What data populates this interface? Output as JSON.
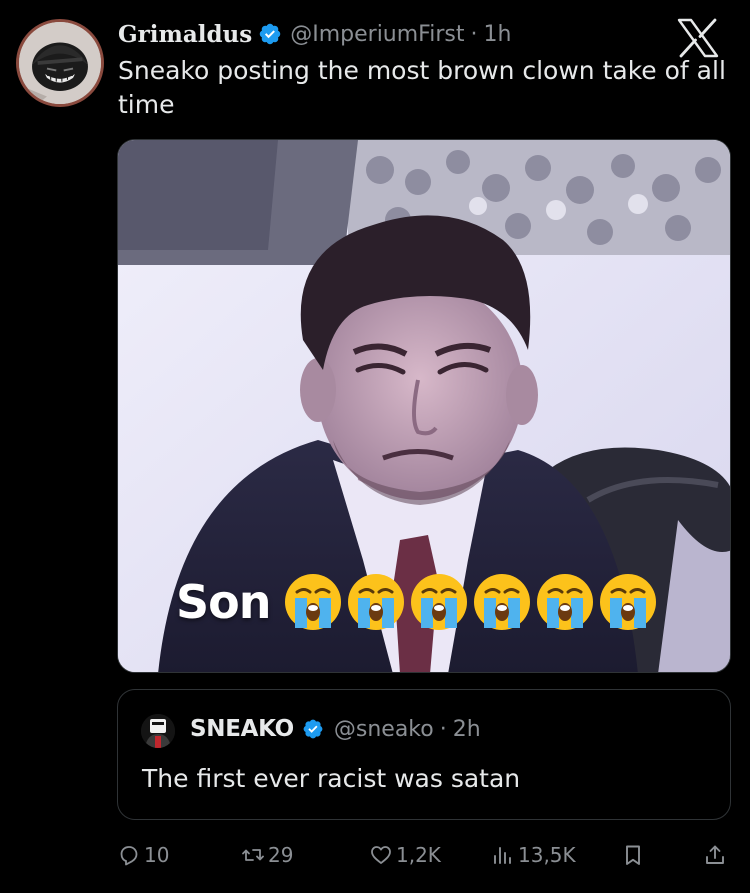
{
  "tweet": {
    "display_name": "Grimaldus",
    "handle": "@ImperiumFirst",
    "time": "1h",
    "text": "Sneako posting the most brown clown take of all time",
    "avatar_icon": "helmet-avatar-icon",
    "verified_color": "#1d9bf0"
  },
  "media": {
    "caption": "Son",
    "emoji": "loudly-crying-face-emoji",
    "emoji_count": 6
  },
  "quote": {
    "display_name": "SNEAKO",
    "handle": "@sneako",
    "time": "2h",
    "text": "The first ever racist was satan"
  },
  "actions": {
    "replies": "10",
    "retweets": "29",
    "likes": "1,2K",
    "views": "13,5K"
  },
  "separator": "·"
}
